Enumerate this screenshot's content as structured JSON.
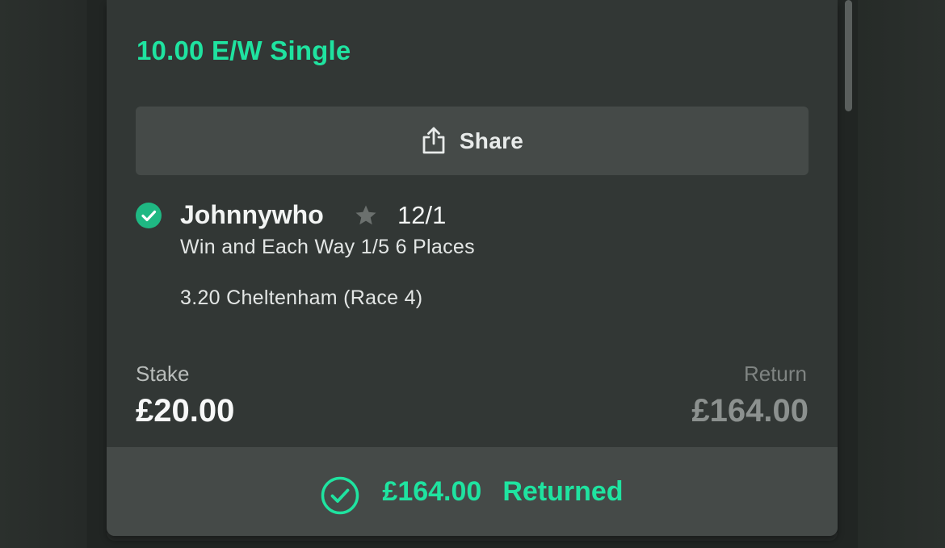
{
  "bet": {
    "title": "10.00 E/W Single"
  },
  "share": {
    "label": "Share"
  },
  "selection": {
    "name": "Johnnywho",
    "odds": "12/1",
    "market": "Win and Each Way 1/5 6 Places",
    "event": "3.20 Cheltenham (Race 4)",
    "status_icon": "check-circle-icon",
    "favourite_icon": "star-icon"
  },
  "stake": {
    "label": "Stake",
    "value": "£20.00"
  },
  "return": {
    "label": "Return",
    "value": "£164.00"
  },
  "result": {
    "amount": "£164.00",
    "label": "Returned",
    "icon": "check-circle-outline-icon"
  },
  "colors": {
    "accent": "#1fe3a0",
    "card_background": "#323735",
    "button_background": "#454a48"
  }
}
